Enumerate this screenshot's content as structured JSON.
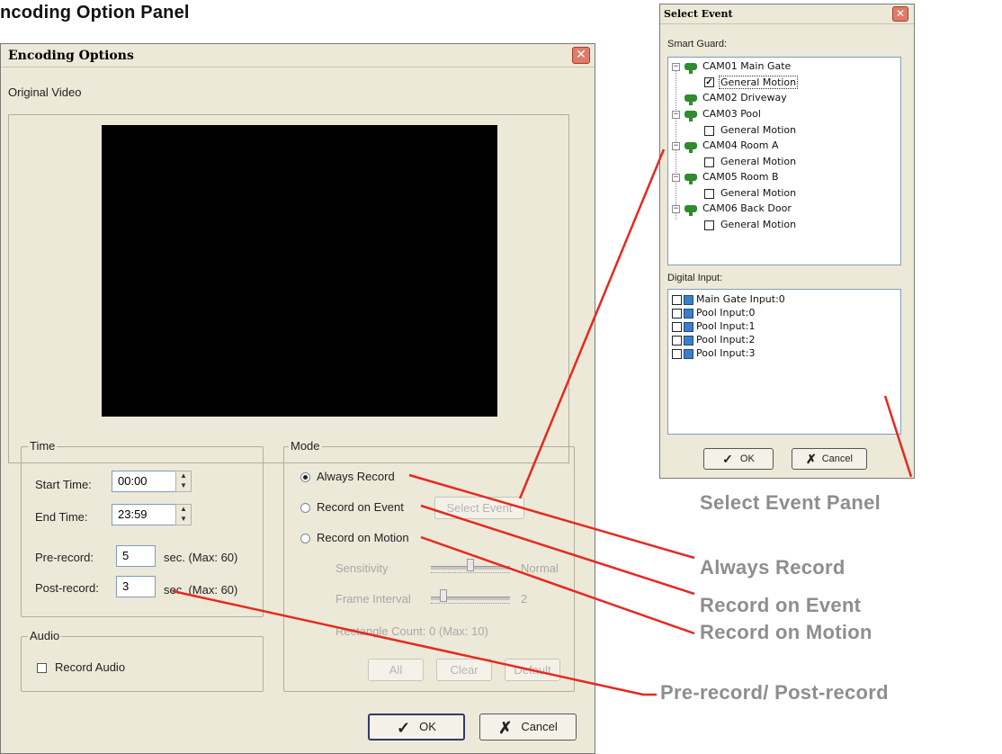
{
  "heading": "ncoding Option Panel",
  "encoding": {
    "title": "Encoding Options",
    "original_video": "Original Video",
    "time": {
      "legend": "Time",
      "start_label": "Start Time:",
      "start_value": "00:00",
      "end_label": "End Time:",
      "end_value": "23:59",
      "pre_label": "Pre-record:",
      "pre_value": "5",
      "pre_unit": "sec. (Max: 60)",
      "post_label": "Post-record:",
      "post_value": "3",
      "post_unit": "sec. (Max: 60)"
    },
    "audio": {
      "legend": "Audio",
      "record_audio": "Record Audio"
    },
    "mode": {
      "legend": "Mode",
      "always": "Always Record",
      "on_event": "Record on Event",
      "select_event": "Select Event",
      "on_motion": "Record on Motion",
      "sensitivity": "Sensitivity",
      "sensitivity_value": "Normal",
      "frame_interval": "Frame Interval",
      "frame_interval_value": "2",
      "rect_count": "Rectangle Count: 0  (Max: 10)",
      "all": "All",
      "clear": "Clear",
      "default": "Default"
    },
    "ok": "OK",
    "cancel": "Cancel"
  },
  "select_event": {
    "title": "Select Event",
    "smart_guard": "Smart Guard:",
    "cameras": [
      {
        "name": "CAM01 Main Gate",
        "motion": "General Motion",
        "checked": true
      },
      {
        "name": "CAM02 Driveway"
      },
      {
        "name": "CAM03 Pool",
        "motion": "General Motion",
        "checked": false
      },
      {
        "name": "CAM04 Room A",
        "motion": "General Motion",
        "checked": false
      },
      {
        "name": "CAM05 Room B",
        "motion": "General Motion",
        "checked": false
      },
      {
        "name": "CAM06 Back Door",
        "motion": "General Motion",
        "checked": false
      }
    ],
    "digital_input": "Digital Input:",
    "inputs": [
      "Main Gate Input:0",
      "Pool Input:0",
      "Pool Input:1",
      "Pool Input:2",
      "Pool Input:3"
    ],
    "ok": "OK",
    "cancel": "Cancel"
  },
  "callouts": {
    "select_event_panel": "Select Event Panel",
    "always_record": "Always Record",
    "record_on_event": "Record on Event",
    "record_on_motion": "Record on Motion",
    "pre_post_record": "Pre-record/ Post-record"
  },
  "colors": {
    "callout_line": "#e8281e",
    "dialog_bg": "#ece9d8",
    "callout_text": "#8e8e8e"
  }
}
